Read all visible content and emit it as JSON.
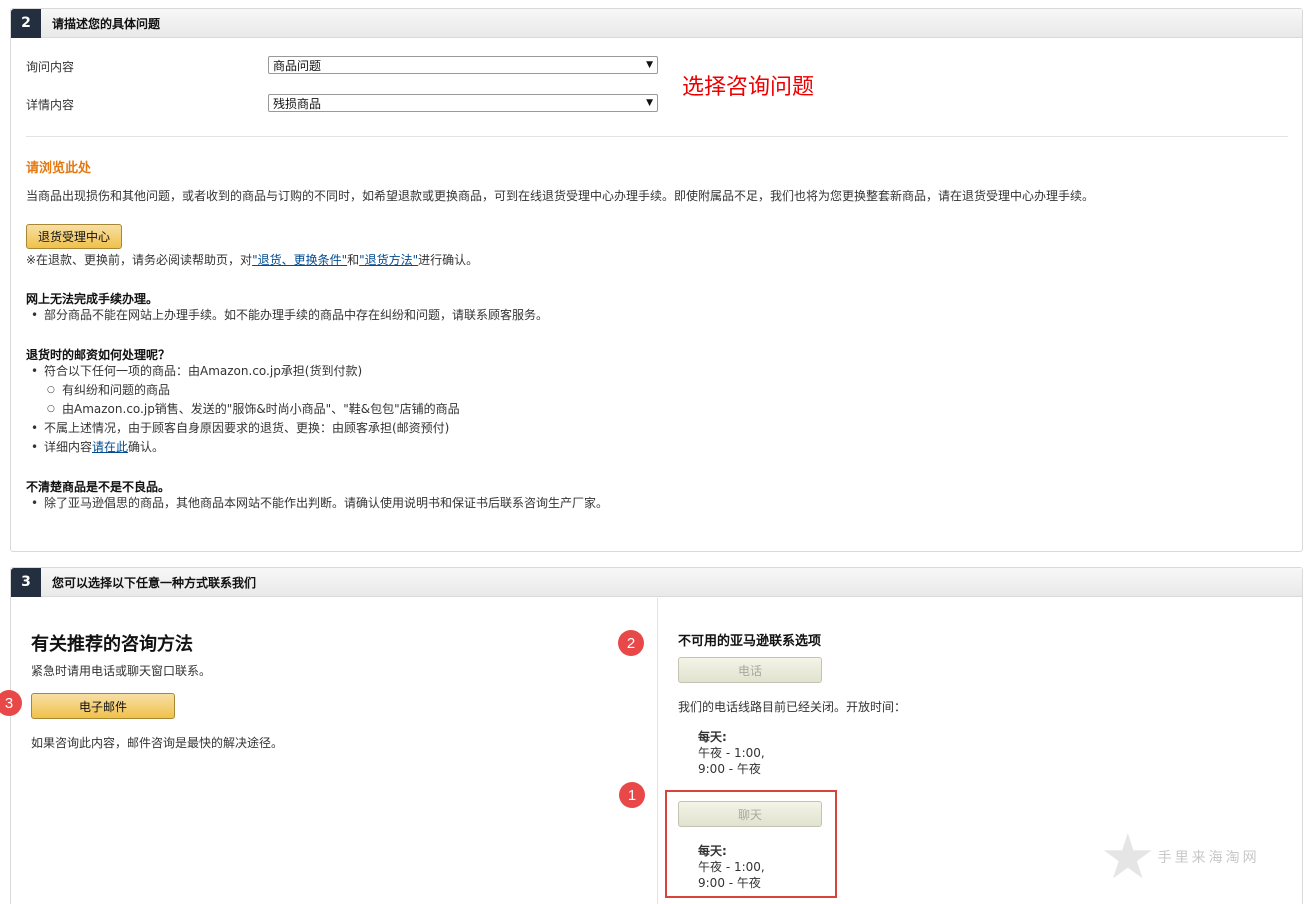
{
  "section2": {
    "number": "2",
    "title": "请描述您的具体问题",
    "inquiry_label": "询问内容",
    "inquiry_value": "商品问题",
    "detail_label": "详情内容",
    "detail_value": "残损商品",
    "annotation": "选择咨询问题",
    "browse_heading": "请浏览此处",
    "browse_text": "当商品出现损伤和其他问题，或者收到的商品与订购的不同时，如希望退款或更换商品，可到在线退货受理中心办理手续。即使附属品不足，我们也将为您更换整套新商品，请在退货受理中心办理手续。",
    "return_center_button": "退货受理中心",
    "note_prefix": "※在退款、更换前，请务必阅读帮助页，对",
    "note_link1": "\"退货、更换条件\"",
    "note_mid": "和",
    "note_link2": "\"退货方法\"",
    "note_suffix": "进行确认。",
    "online_heading": "网上无法完成手续办理。",
    "online_item": "部分商品不能在网站上办理手续。如不能办理手续的商品中存在纠纷和问题，请联系顾客服务。",
    "postage_heading": "退货时的邮资如何处理呢？",
    "postage_item1": "符合以下任何一项的商品：由Amazon.co.jp承担(货到付款)",
    "postage_sub1": "有纠纷和问题的商品",
    "postage_sub2": "由Amazon.co.jp销售、发送的\"服饰&时尚小商品\"、\"鞋&包包\"店铺的商品",
    "postage_item2": "不属上述情况，由于顾客自身原因要求的退货、更换：由顾客承担(邮资预付)",
    "postage_item3_prefix": "详细内容",
    "postage_item3_link": "请在此",
    "postage_item3_suffix": "确认。",
    "defect_heading": "不清楚商品是不是不良品。",
    "defect_item": "除了亚马逊倡思的商品，其他商品本网站不能作出判断。请确认使用说明书和保证书后联系咨询生产厂家。"
  },
  "section3": {
    "number": "3",
    "title": "您可以选择以下任意一种方式联系我们",
    "recommended_title": "有关推荐的咨询方法",
    "recommended_sub": "紧急时请用电话或聊天窗口联系。",
    "email_button": "电子邮件",
    "email_note": "如果咨询此内容，邮件咨询是最快的解决途径。",
    "unavailable_title": "不可用的亚马逊联系选项",
    "phone_button": "电话",
    "phone_closed_text": "我们的电话线路目前已经关闭。开放时间：",
    "phone_days": "每天:",
    "phone_hours1": "午夜 - 1:00,",
    "phone_hours2": "9:00 - 午夜",
    "chat_button": "聊天",
    "chat_days": "每天:",
    "chat_hours1": "午夜 - 1:00,",
    "chat_hours2": "9:00 - 午夜",
    "badge1": "1",
    "badge2": "2",
    "badge3": "3"
  },
  "watermark": "手里来海淘网",
  "colors": {
    "accent_orange": "#e47911",
    "annotation_red": "#e00000",
    "badge_red": "#e84848",
    "header_dark": "#232f3e"
  }
}
